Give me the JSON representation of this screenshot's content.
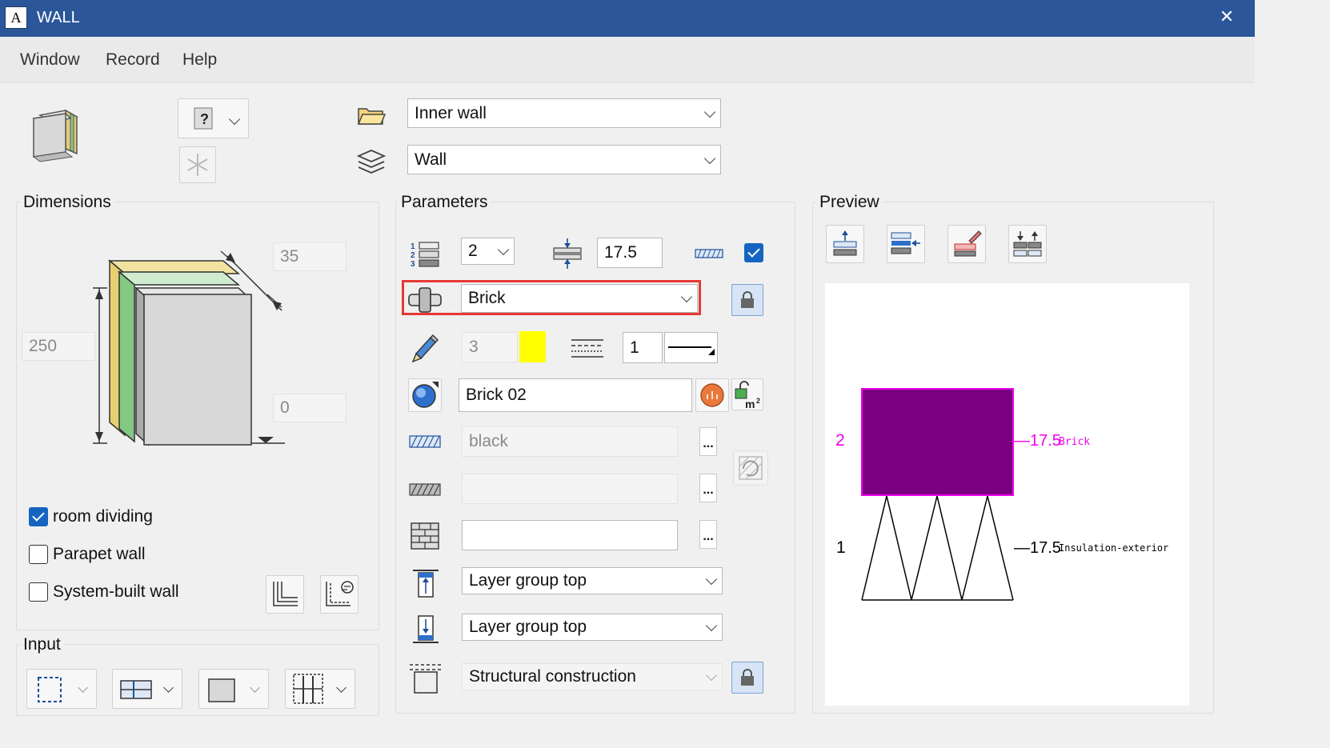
{
  "window": {
    "title": "WALL",
    "app_icon_letter": "A",
    "close_glyph": "✕"
  },
  "menu": [
    "Window",
    "Record",
    "Help"
  ],
  "top": {
    "category": "Inner wall",
    "type": "Wall"
  },
  "dimensions": {
    "label": "Dimensions",
    "thickness": "35",
    "height": "250",
    "offset": "0",
    "room_dividing": {
      "label": "room dividing",
      "checked": true
    },
    "parapet_wall": {
      "label": "Parapet wall",
      "checked": false
    },
    "system_built_wall": {
      "label": "System-built wall",
      "checked": false
    }
  },
  "input": {
    "label": "Input"
  },
  "parameters": {
    "label": "Parameters",
    "layer_number": "2",
    "layer_thickness": "17.5",
    "material": "Brick",
    "pen_number": "3",
    "pen_color": "#ffff00",
    "line_type": "1",
    "surface": "Brick 02",
    "hatch_color": "black",
    "pattern": "",
    "fill": "",
    "top_attachment": "Layer group top",
    "bottom_attachment": "Layer group top",
    "construction": "Structural construction"
  },
  "preview": {
    "label": "Preview",
    "layers": [
      {
        "index": "2",
        "thickness": "—17.5",
        "name": "Brick",
        "color": "#ee00ee"
      },
      {
        "index": "1",
        "thickness": "—17.5",
        "name": "Insulation-exterior",
        "color": "#000000"
      }
    ],
    "fill_color": "#7b0080"
  },
  "colors": {
    "titlebar": "#2b579a",
    "accent": "#1565c0",
    "highlight": "#e53935"
  }
}
